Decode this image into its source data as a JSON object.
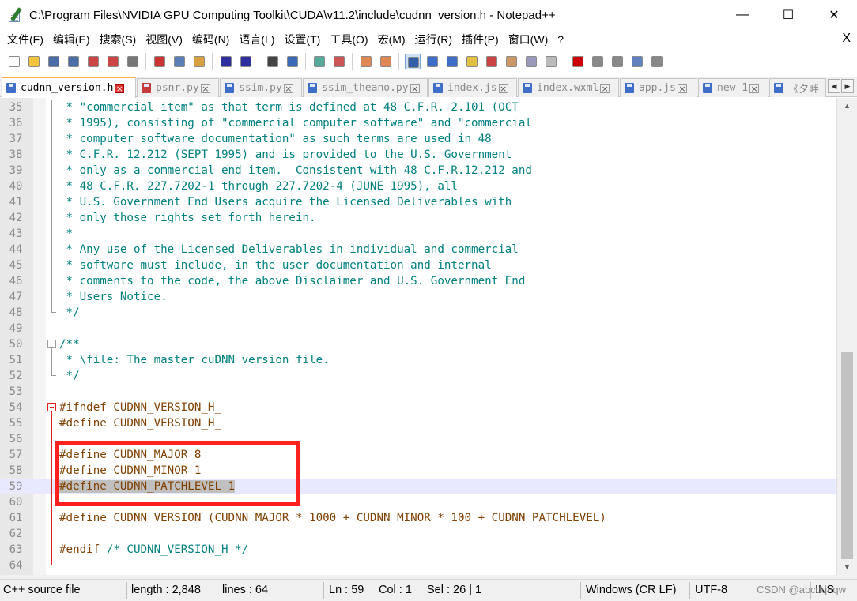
{
  "window": {
    "title": "C:\\Program Files\\NVIDIA GPU Computing Toolkit\\CUDA\\v11.2\\include\\cudnn_version.h - Notepad++",
    "minimize_glyph": "—",
    "maximize_glyph": "☐",
    "close_glyph": "✕"
  },
  "menu": {
    "items": [
      "文件(F)",
      "编辑(E)",
      "搜索(S)",
      "视图(V)",
      "编码(N)",
      "语言(L)",
      "设置(T)",
      "工具(O)",
      "宏(M)",
      "运行(R)",
      "插件(P)",
      "窗口(W)",
      "?"
    ],
    "close_glyph": "X"
  },
  "toolbar": {
    "icons": [
      "new-file-icon",
      "open-file-icon",
      "save-icon",
      "save-all-icon",
      "close-icon",
      "close-all-icon",
      "print-icon",
      "cut-icon",
      "copy-icon",
      "paste-icon",
      "undo-icon",
      "redo-icon",
      "find-icon",
      "replace-icon",
      "zoom-in-icon",
      "zoom-out-icon",
      "sync-vertical-icon",
      "sync-horizontal-icon",
      "word-wrap-icon",
      "show-all-characters-icon",
      "indent-guide-icon",
      "doc-map-icon",
      "function-list-icon",
      "folder-as-workspace-icon",
      "doc-list-icon",
      "monitoring-icon",
      "record-macro-icon",
      "stop-macro-icon",
      "play-macro-icon",
      "run-macro-multiple-icon",
      "save-macro-icon"
    ]
  },
  "tabs": [
    {
      "label": "cudnn_version.h",
      "active": true,
      "unsaved": false
    },
    {
      "label": "psnr.py",
      "active": false,
      "unsaved": true
    },
    {
      "label": "ssim.py",
      "active": false,
      "unsaved": false
    },
    {
      "label": "ssim_theano.py",
      "active": false,
      "unsaved": false
    },
    {
      "label": "index.js",
      "active": false,
      "unsaved": false
    },
    {
      "label": "index.wxml",
      "active": false,
      "unsaved": false
    },
    {
      "label": "app.js",
      "active": false,
      "unsaved": false
    },
    {
      "label": "new 1",
      "active": false,
      "unsaved": false
    },
    {
      "label": "《夕畔",
      "active": false,
      "unsaved": false
    }
  ],
  "tab_scroll": {
    "left": "◀",
    "right": "▶"
  },
  "editor": {
    "current_line": 59,
    "lines": [
      {
        "n": "35",
        "parts": [
          {
            "t": " * \"commercial item\" as that term is defined at 48 C.F.R. 2.101 (OCT",
            "c": "comment"
          }
        ]
      },
      {
        "n": "36",
        "parts": [
          {
            "t": " * 1995), consisting of \"commercial computer software\" and \"commercial",
            "c": "comment"
          }
        ]
      },
      {
        "n": "37",
        "parts": [
          {
            "t": " * computer software documentation\" as such terms are used in 48",
            "c": "comment"
          }
        ]
      },
      {
        "n": "38",
        "parts": [
          {
            "t": " * C.F.R. 12.212 (SEPT 1995) and is provided to the U.S. Government",
            "c": "comment"
          }
        ]
      },
      {
        "n": "39",
        "parts": [
          {
            "t": " * only as a commercial end item.  Consistent with 48 C.F.R.12.212 and",
            "c": "comment"
          }
        ]
      },
      {
        "n": "40",
        "parts": [
          {
            "t": " * 48 C.F.R. 227.7202-1 through 227.7202-4 (JUNE 1995), all",
            "c": "comment"
          }
        ]
      },
      {
        "n": "41",
        "parts": [
          {
            "t": " * U.S. Government End Users acquire the Licensed Deliverables with",
            "c": "comment"
          }
        ]
      },
      {
        "n": "42",
        "parts": [
          {
            "t": " * only those rights set forth herein.",
            "c": "comment"
          }
        ]
      },
      {
        "n": "43",
        "parts": [
          {
            "t": " *",
            "c": "comment"
          }
        ]
      },
      {
        "n": "44",
        "parts": [
          {
            "t": " * Any use of the Licensed Deliverables in individual and commercial",
            "c": "comment"
          }
        ]
      },
      {
        "n": "45",
        "parts": [
          {
            "t": " * software must include, in the user documentation and internal",
            "c": "comment"
          }
        ]
      },
      {
        "n": "46",
        "parts": [
          {
            "t": " * comments to the code, the above Disclaimer and U.S. Government End",
            "c": "comment"
          }
        ]
      },
      {
        "n": "47",
        "parts": [
          {
            "t": " * Users Notice.",
            "c": "comment"
          }
        ]
      },
      {
        "n": "48",
        "parts": [
          {
            "t": " */",
            "c": "comment"
          }
        ]
      },
      {
        "n": "49",
        "parts": []
      },
      {
        "n": "50",
        "parts": [
          {
            "t": "/**",
            "c": "comment"
          }
        ]
      },
      {
        "n": "51",
        "parts": [
          {
            "t": " * \\file: The master cuDNN version file.",
            "c": "comment"
          }
        ]
      },
      {
        "n": "52",
        "parts": [
          {
            "t": " */",
            "c": "comment"
          }
        ]
      },
      {
        "n": "53",
        "parts": []
      },
      {
        "n": "54",
        "parts": [
          {
            "t": "#ifndef CUDNN_VERSION_H_",
            "c": "pre"
          }
        ]
      },
      {
        "n": "55",
        "parts": [
          {
            "t": "#define CUDNN_VERSION_H_",
            "c": "pre"
          }
        ]
      },
      {
        "n": "56",
        "parts": []
      },
      {
        "n": "57",
        "parts": [
          {
            "t": "#define CUDNN_MAJOR 8",
            "c": "pre"
          }
        ]
      },
      {
        "n": "58",
        "parts": [
          {
            "t": "#define CUDNN_MINOR 1",
            "c": "pre"
          }
        ]
      },
      {
        "n": "59",
        "parts": [
          {
            "t": "#define CUDNN_PATCHLEVEL 1",
            "c": "pre",
            "sel": true
          }
        ]
      },
      {
        "n": "60",
        "parts": []
      },
      {
        "n": "61",
        "parts": [
          {
            "t": "#define CUDNN_VERSION (CUDNN_MAJOR * 1000 + CUDNN_MINOR * 100 + CUDNN_PATCHLEVEL)",
            "c": "pre"
          }
        ]
      },
      {
        "n": "62",
        "parts": []
      },
      {
        "n": "63",
        "parts": [
          {
            "t": "#endif ",
            "c": "pre"
          },
          {
            "t": "/* CUDNN_VERSION_H */",
            "c": "comment"
          }
        ]
      },
      {
        "n": "64",
        "parts": []
      }
    ]
  },
  "statusbar": {
    "language": "C++ source file",
    "length": "length : 2,848",
    "lines": "lines : 64",
    "ln": "Ln : 59",
    "col": "Col : 1",
    "sel": "Sel : 26 | 1",
    "eol": "Windows (CR LF)",
    "encoding": "UTF-8",
    "mode": "INS",
    "watermark": "CSDN @abcdqnqw"
  }
}
